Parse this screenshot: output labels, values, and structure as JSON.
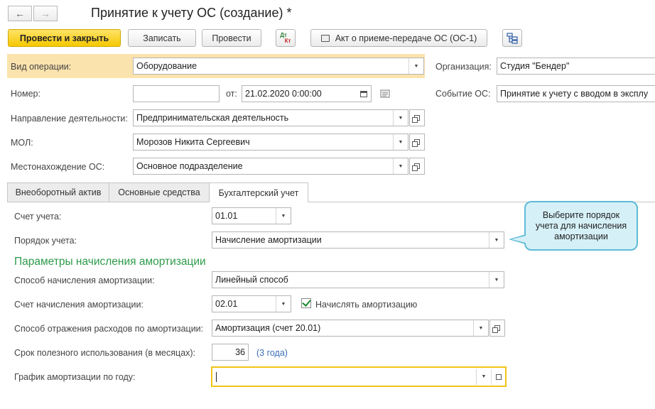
{
  "window": {
    "title": "Принятие к учету ОС (создание) *"
  },
  "nav": {
    "back_icon": "arrow-left-icon",
    "forward_icon": "arrow-right-icon"
  },
  "toolbar": {
    "post_close": "Провести и закрыть",
    "save": "Записать",
    "post": "Провести",
    "dt_label": "Дт",
    "kt_label": "Кт",
    "act": "Акт о приеме-передаче ОС (ОС-1)",
    "colors": {
      "primary_bg": "#f5c800",
      "dt": "#2e7d32",
      "kt": "#c62828"
    }
  },
  "header": {
    "operation_label": "Вид операции:",
    "operation_value": "Оборудование",
    "org_label": "Организация:",
    "org_value": "Студия \"Бендер\"",
    "number_label": "Номер:",
    "number_value": "",
    "from_label": "от:",
    "date_value": "21.02.2020  0:00:00",
    "event_label": "Событие ОС:",
    "event_value": "Принятие к учету с вводом в эксплу",
    "direction_label": "Направление деятельности:",
    "direction_value": "Предпринимательская деятельность",
    "mol_label": "МОЛ:",
    "mol_value": "Морозов Никита Сергеевич",
    "location_label": "Местонахождение ОС:",
    "location_value": "Основное подразделение",
    "highlight_color": "#fbe3ad"
  },
  "tabs": [
    {
      "label": "Внеоборотный актив"
    },
    {
      "label": "Основные средства"
    },
    {
      "label": "Бухгалтерский учет"
    }
  ],
  "accounting": {
    "account_label": "Счет учета:",
    "account_value": "01.01",
    "order_label": "Порядок учета:",
    "order_value": "Начисление амортизации",
    "section_title": "Параметры начисления амортизации",
    "method_label": "Способ начисления амортизации:",
    "method_value": "Линейный способ",
    "dep_account_label": "Счет начисления амортизации:",
    "dep_account_value": "02.01",
    "accrue_label": "Начислять амортизацию",
    "accrue_checked": true,
    "expense_label": "Способ отражения расходов по амортизации:",
    "expense_value": "Амортизация (счет 20.01)",
    "life_label": "Срок полезного использования (в месяцах):",
    "life_value": "36",
    "life_years": "(3 года)",
    "schedule_label": "График амортизации по году:",
    "schedule_value": "",
    "section_color": "#2d9b4a",
    "link_color": "#3b6fb6",
    "focus_color": "#f0c419"
  },
  "tooltip": {
    "text": "Выберите порядок учета для начисления амортизации",
    "bg": "#d5f0f7",
    "border": "#5fbbd6"
  }
}
